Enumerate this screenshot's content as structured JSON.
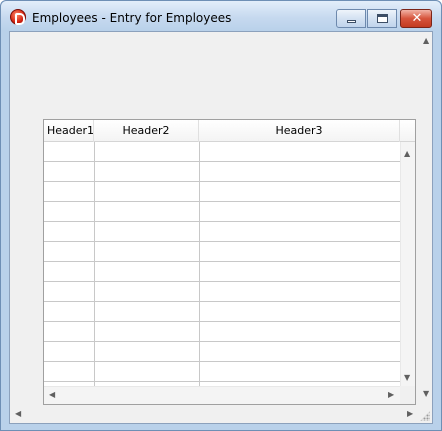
{
  "window": {
    "title": "Employees - Entry for Employees",
    "controls": {
      "minimize_glyph": "",
      "maximize_glyph": "",
      "close_glyph": "✕"
    }
  },
  "grid": {
    "headers": [
      "Header1",
      "Header2",
      "Header3"
    ],
    "row_count": 12
  },
  "icons": {
    "app": "app-logo-icon",
    "scroll_up": "▲",
    "scroll_down": "▼",
    "scroll_left": "◀",
    "scroll_right": "▶"
  },
  "colors": {
    "titlebar": "#c6d9ef",
    "client_background": "#f0f0f0",
    "close_button": "#d6543c"
  }
}
